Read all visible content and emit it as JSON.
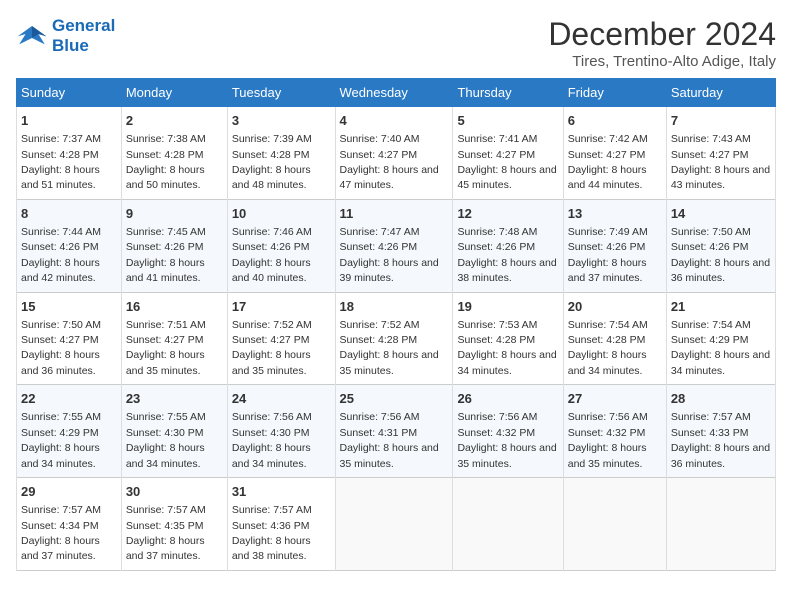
{
  "logo": {
    "line1": "General",
    "line2": "Blue"
  },
  "title": "December 2024",
  "subtitle": "Tires, Trentino-Alto Adige, Italy",
  "weekdays": [
    "Sunday",
    "Monday",
    "Tuesday",
    "Wednesday",
    "Thursday",
    "Friday",
    "Saturday"
  ],
  "weeks": [
    [
      {
        "day": "1",
        "sunrise": "7:37 AM",
        "sunset": "4:28 PM",
        "daylight": "8 hours and 51 minutes."
      },
      {
        "day": "2",
        "sunrise": "7:38 AM",
        "sunset": "4:28 PM",
        "daylight": "8 hours and 50 minutes."
      },
      {
        "day": "3",
        "sunrise": "7:39 AM",
        "sunset": "4:28 PM",
        "daylight": "8 hours and 48 minutes."
      },
      {
        "day": "4",
        "sunrise": "7:40 AM",
        "sunset": "4:27 PM",
        "daylight": "8 hours and 47 minutes."
      },
      {
        "day": "5",
        "sunrise": "7:41 AM",
        "sunset": "4:27 PM",
        "daylight": "8 hours and 45 minutes."
      },
      {
        "day": "6",
        "sunrise": "7:42 AM",
        "sunset": "4:27 PM",
        "daylight": "8 hours and 44 minutes."
      },
      {
        "day": "7",
        "sunrise": "7:43 AM",
        "sunset": "4:27 PM",
        "daylight": "8 hours and 43 minutes."
      }
    ],
    [
      {
        "day": "8",
        "sunrise": "7:44 AM",
        "sunset": "4:26 PM",
        "daylight": "8 hours and 42 minutes."
      },
      {
        "day": "9",
        "sunrise": "7:45 AM",
        "sunset": "4:26 PM",
        "daylight": "8 hours and 41 minutes."
      },
      {
        "day": "10",
        "sunrise": "7:46 AM",
        "sunset": "4:26 PM",
        "daylight": "8 hours and 40 minutes."
      },
      {
        "day": "11",
        "sunrise": "7:47 AM",
        "sunset": "4:26 PM",
        "daylight": "8 hours and 39 minutes."
      },
      {
        "day": "12",
        "sunrise": "7:48 AM",
        "sunset": "4:26 PM",
        "daylight": "8 hours and 38 minutes."
      },
      {
        "day": "13",
        "sunrise": "7:49 AM",
        "sunset": "4:26 PM",
        "daylight": "8 hours and 37 minutes."
      },
      {
        "day": "14",
        "sunrise": "7:50 AM",
        "sunset": "4:26 PM",
        "daylight": "8 hours and 36 minutes."
      }
    ],
    [
      {
        "day": "15",
        "sunrise": "7:50 AM",
        "sunset": "4:27 PM",
        "daylight": "8 hours and 36 minutes."
      },
      {
        "day": "16",
        "sunrise": "7:51 AM",
        "sunset": "4:27 PM",
        "daylight": "8 hours and 35 minutes."
      },
      {
        "day": "17",
        "sunrise": "7:52 AM",
        "sunset": "4:27 PM",
        "daylight": "8 hours and 35 minutes."
      },
      {
        "day": "18",
        "sunrise": "7:52 AM",
        "sunset": "4:28 PM",
        "daylight": "8 hours and 35 minutes."
      },
      {
        "day": "19",
        "sunrise": "7:53 AM",
        "sunset": "4:28 PM",
        "daylight": "8 hours and 34 minutes."
      },
      {
        "day": "20",
        "sunrise": "7:54 AM",
        "sunset": "4:28 PM",
        "daylight": "8 hours and 34 minutes."
      },
      {
        "day": "21",
        "sunrise": "7:54 AM",
        "sunset": "4:29 PM",
        "daylight": "8 hours and 34 minutes."
      }
    ],
    [
      {
        "day": "22",
        "sunrise": "7:55 AM",
        "sunset": "4:29 PM",
        "daylight": "8 hours and 34 minutes."
      },
      {
        "day": "23",
        "sunrise": "7:55 AM",
        "sunset": "4:30 PM",
        "daylight": "8 hours and 34 minutes."
      },
      {
        "day": "24",
        "sunrise": "7:56 AM",
        "sunset": "4:30 PM",
        "daylight": "8 hours and 34 minutes."
      },
      {
        "day": "25",
        "sunrise": "7:56 AM",
        "sunset": "4:31 PM",
        "daylight": "8 hours and 35 minutes."
      },
      {
        "day": "26",
        "sunrise": "7:56 AM",
        "sunset": "4:32 PM",
        "daylight": "8 hours and 35 minutes."
      },
      {
        "day": "27",
        "sunrise": "7:56 AM",
        "sunset": "4:32 PM",
        "daylight": "8 hours and 35 minutes."
      },
      {
        "day": "28",
        "sunrise": "7:57 AM",
        "sunset": "4:33 PM",
        "daylight": "8 hours and 36 minutes."
      }
    ],
    [
      {
        "day": "29",
        "sunrise": "7:57 AM",
        "sunset": "4:34 PM",
        "daylight": "8 hours and 37 minutes."
      },
      {
        "day": "30",
        "sunrise": "7:57 AM",
        "sunset": "4:35 PM",
        "daylight": "8 hours and 37 minutes."
      },
      {
        "day": "31",
        "sunrise": "7:57 AM",
        "sunset": "4:36 PM",
        "daylight": "8 hours and 38 minutes."
      },
      null,
      null,
      null,
      null
    ]
  ],
  "labels": {
    "sunrise": "Sunrise:",
    "sunset": "Sunset:",
    "daylight": "Daylight:"
  }
}
